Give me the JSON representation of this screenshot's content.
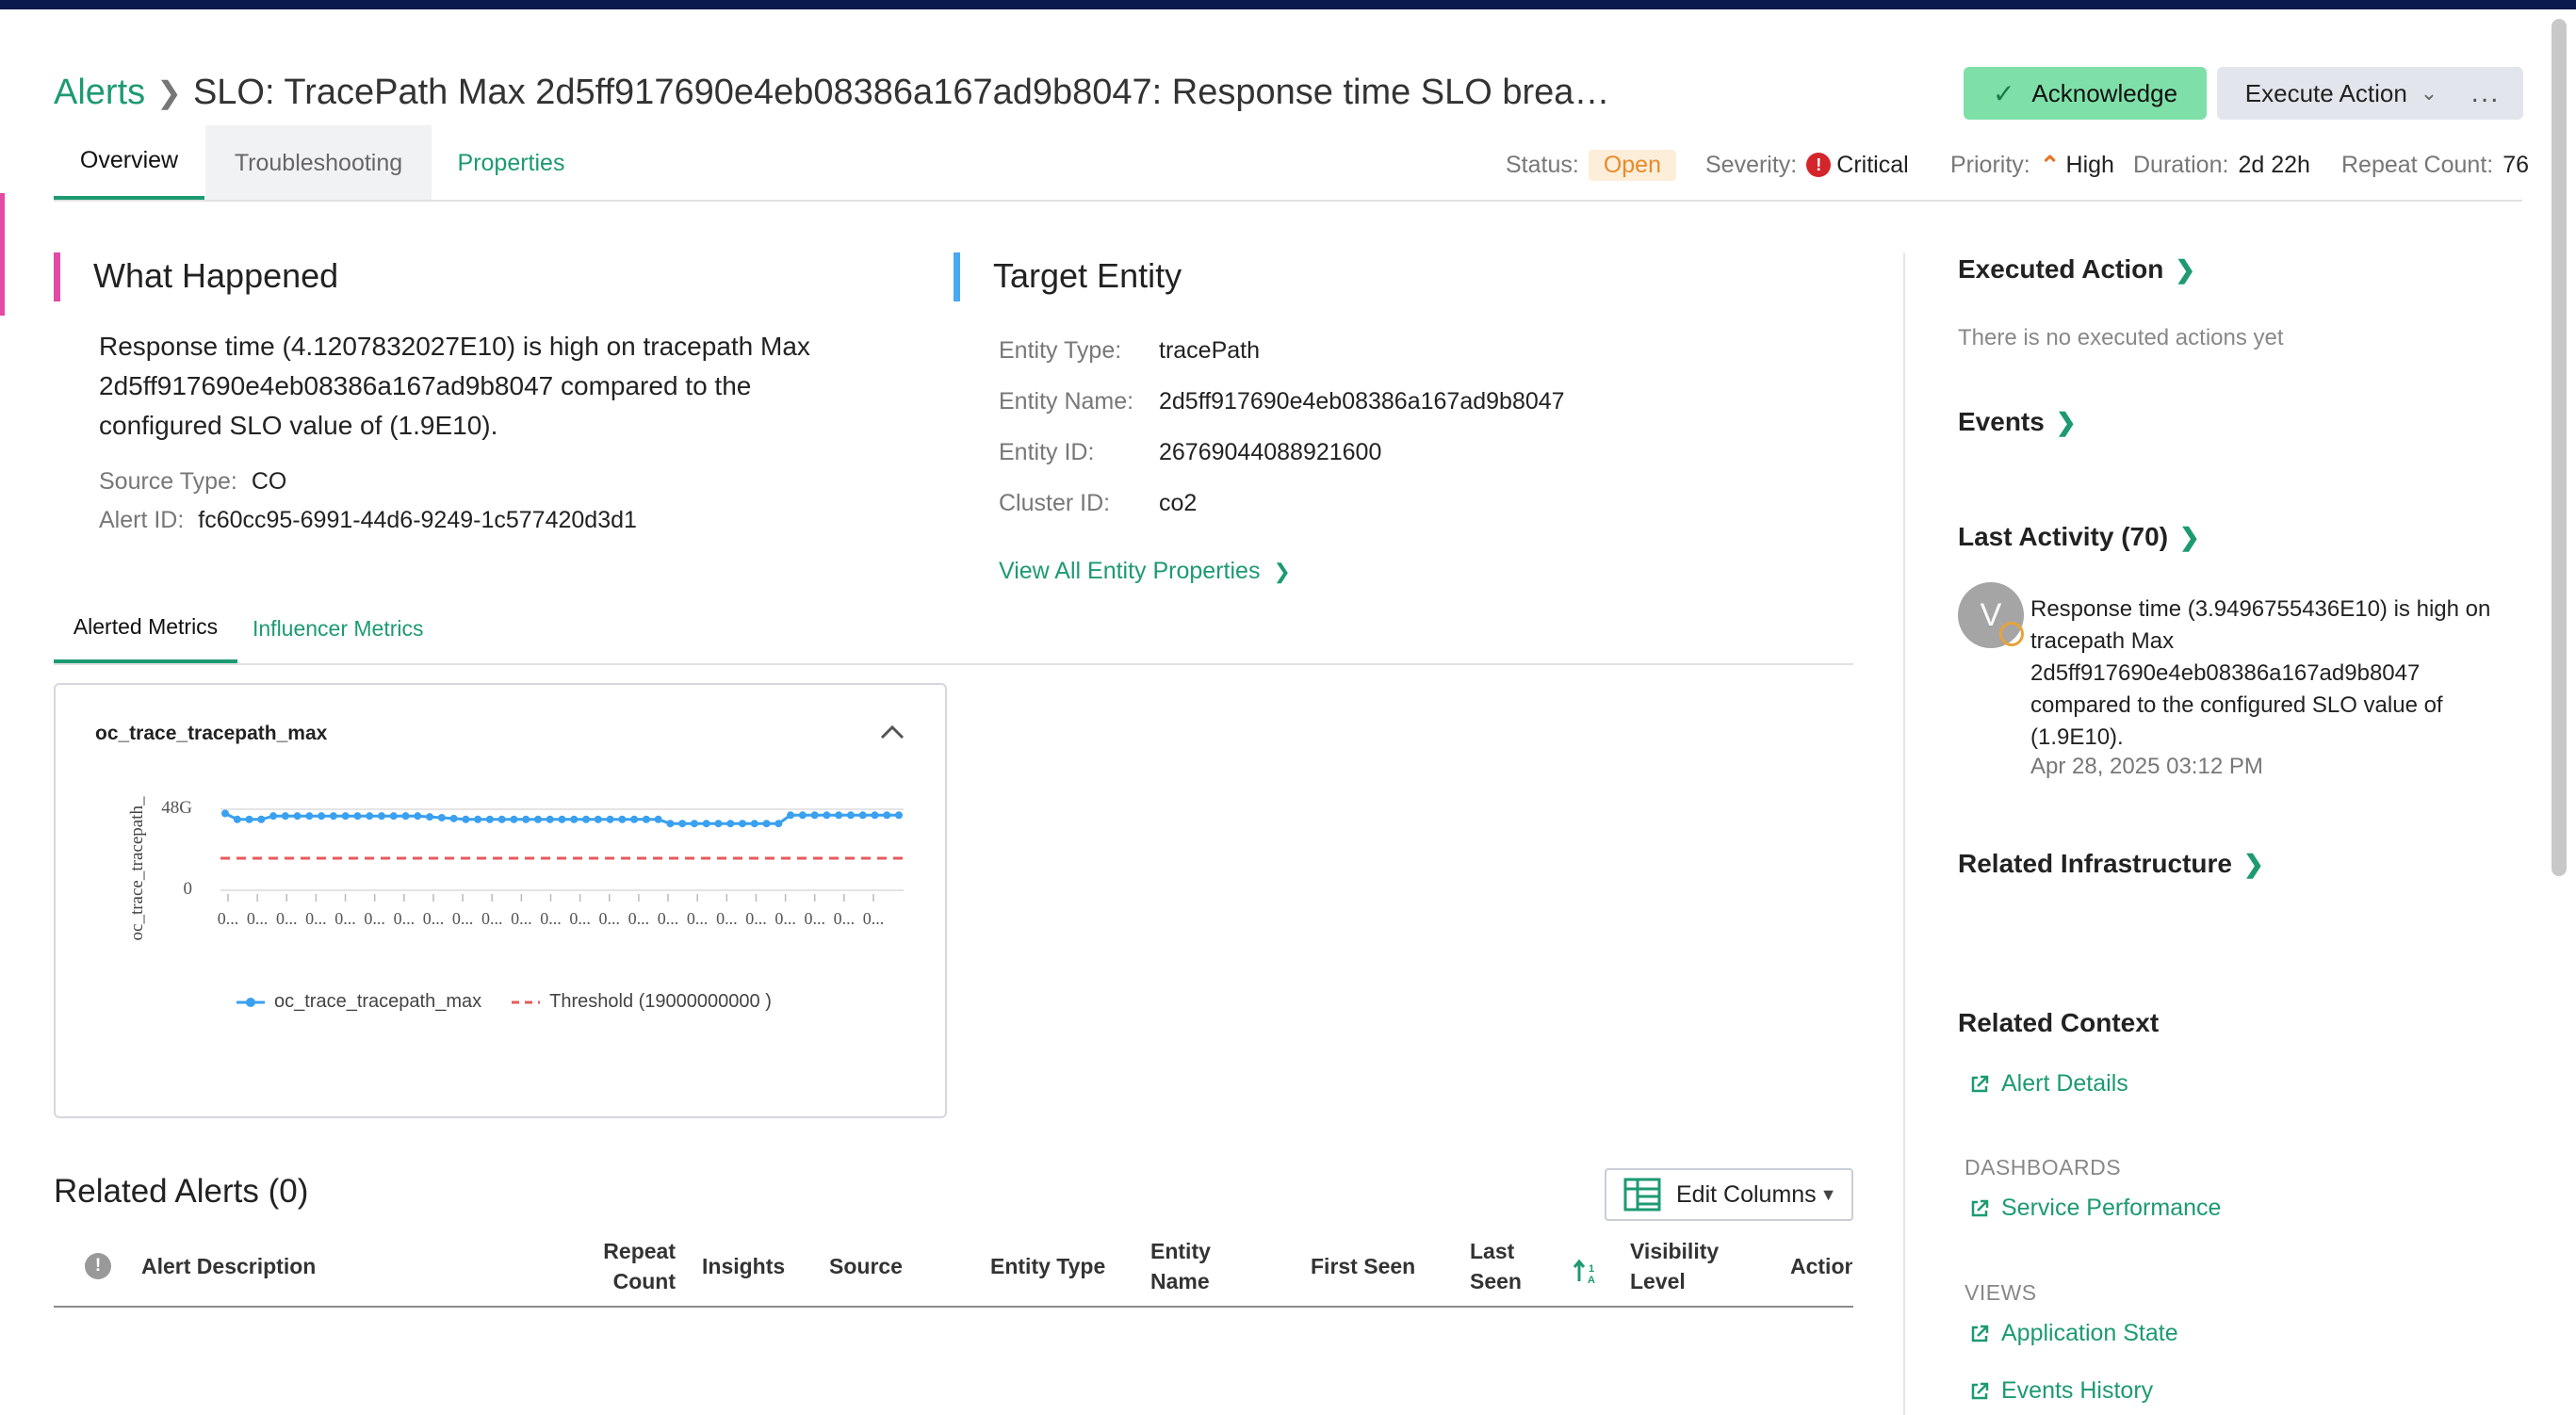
{
  "header": {
    "breadcrumb_root": "Alerts",
    "title": "SLO: TracePath Max 2d5ff917690e4eb08386a167ad9b8047: Response time SLO breach detected based on p...",
    "acknowledge_label": "Acknowledge",
    "execute_action_label": "Execute Action",
    "more_label": "..."
  },
  "tabs": [
    {
      "label": "Overview",
      "active": true
    },
    {
      "label": "Troubleshooting",
      "active": false
    },
    {
      "label": "Properties",
      "active": false
    }
  ],
  "status_bar": {
    "status_label": "Status:",
    "status_value": "Open",
    "severity_label": "Severity:",
    "severity_value": "Critical",
    "severity_icon_glyph": "!",
    "priority_label": "Priority:",
    "priority_value": "High",
    "duration_label": "Duration:",
    "duration_value": "2d 22h",
    "repeat_label": "Repeat Count:",
    "repeat_value": "76"
  },
  "what_happened": {
    "title": "What Happened",
    "description": "Response time (4.1207832027E10) is high on tracepath Max 2d5ff917690e4eb08386a167ad9b8047 compared to the configured SLO value of (1.9E10).",
    "source_type_label": "Source Type:",
    "source_type_value": "CO",
    "alert_id_label": "Alert ID:",
    "alert_id_value": "fc60cc95-6991-44d6-9249-1c577420d3d1"
  },
  "target_entity": {
    "title": "Target Entity",
    "fields": [
      {
        "label": "Entity Type:",
        "value": "tracePath"
      },
      {
        "label": "Entity Name:",
        "value": "2d5ff917690e4eb08386a167ad9b8047"
      },
      {
        "label": "Entity ID:",
        "value": "26769044088921600"
      },
      {
        "label": "Cluster ID:",
        "value": "co2"
      }
    ],
    "view_all_label": "View All Entity Properties"
  },
  "metric_tabs": [
    {
      "label": "Alerted Metrics",
      "active": true
    },
    {
      "label": "Influencer Metrics",
      "active": false
    }
  ],
  "metric_card": {
    "title": "oc_trace_tracepath_max"
  },
  "chart_data": {
    "type": "line",
    "ylabel": "oc_trace_tracepath_",
    "y_tick_labels": [
      "48G",
      "0"
    ],
    "x_tick_label": "0...",
    "x_tick_count": 23,
    "y_scale_max": 48000000000,
    "threshold": 19000000000,
    "series": [
      {
        "name": "oc_trace_tracepath_max",
        "color": "#3aa0f0",
        "values": [
          45500000000,
          42000000000,
          42000000000,
          42000000000,
          44000000000,
          44000000000,
          44000000000,
          44000000000,
          44000000000,
          44000000000,
          44000000000,
          44000000000,
          44000000000,
          44000000000,
          44000000000,
          44000000000,
          44000000000,
          43500000000,
          43000000000,
          42500000000,
          42000000000,
          42000000000,
          42000000000,
          42000000000,
          42000000000,
          42000000000,
          42000000000,
          42000000000,
          42000000000,
          42000000000,
          42000000000,
          42000000000,
          42000000000,
          42000000000,
          42000000000,
          42000000000,
          42000000000,
          39500000000,
          39500000000,
          39500000000,
          39500000000,
          39500000000,
          39500000000,
          39500000000,
          39500000000,
          39500000000,
          39500000000,
          44500000000,
          44500000000,
          44500000000,
          44500000000,
          44500000000,
          44500000000,
          44500000000,
          44500000000,
          44500000000,
          44500000000
        ]
      }
    ],
    "legend": [
      {
        "label": "oc_trace_tracepath_max",
        "color": "#3aa0f0",
        "style": "solid-dot"
      },
      {
        "label": "Threshold (19000000000 )",
        "color": "#e85a5a",
        "style": "dashed"
      }
    ]
  },
  "related_alerts": {
    "title": "Related Alerts (0)",
    "edit_columns_label": "Edit Columns",
    "columns": [
      {
        "key": "alert_description",
        "line1": "Alert Description",
        "line2": ""
      },
      {
        "key": "repeat_count",
        "line1": "Repeat",
        "line2": "Count"
      },
      {
        "key": "insights",
        "line1": "Insights",
        "line2": ""
      },
      {
        "key": "source",
        "line1": "Source",
        "line2": ""
      },
      {
        "key": "entity_type",
        "line1": "Entity Type",
        "line2": ""
      },
      {
        "key": "entity_name",
        "line1": "Entity",
        "line2": "Name"
      },
      {
        "key": "first_seen",
        "line1": "First Seen",
        "line2": ""
      },
      {
        "key": "last_seen",
        "line1": "Last",
        "line2": "Seen"
      },
      {
        "key": "visibility_level",
        "line1": "Visibility",
        "line2": "Level"
      },
      {
        "key": "action",
        "line1": "Action",
        "line2": ""
      }
    ]
  },
  "right_panel": {
    "executed_action_title": "Executed Action",
    "executed_action_empty": "There is no executed actions yet",
    "events_title": "Events",
    "last_activity_title": "Last Activity (70)",
    "activity": {
      "avatar_initial": "V",
      "text": "Response time (3.9496755436E10) is high on tracepath Max 2d5ff917690e4eb08386a167ad9b8047 compared to the configured SLO value of (1.9E10).",
      "timestamp": "Apr 28, 2025 03:12 PM"
    },
    "related_infrastructure_title": "Related Infrastructure",
    "related_context_title": "Related Context",
    "alert_details_label": "Alert Details",
    "dashboards_label": "DASHBOARDS",
    "service_performance_label": "Service Performance",
    "views_label": "VIEWS",
    "application_state_label": "Application State",
    "events_history_label": "Events History"
  },
  "colors": {
    "accent": "#1d9a72",
    "header_bar": "#0b1a4e",
    "pink_accent": "#e34aa4",
    "blue_accent": "#4aa8f0",
    "open_badge_bg": "#fdeeda",
    "open_badge_text": "#e88a2a",
    "critical": "#d4252a",
    "priority_high": "#e8742a"
  }
}
